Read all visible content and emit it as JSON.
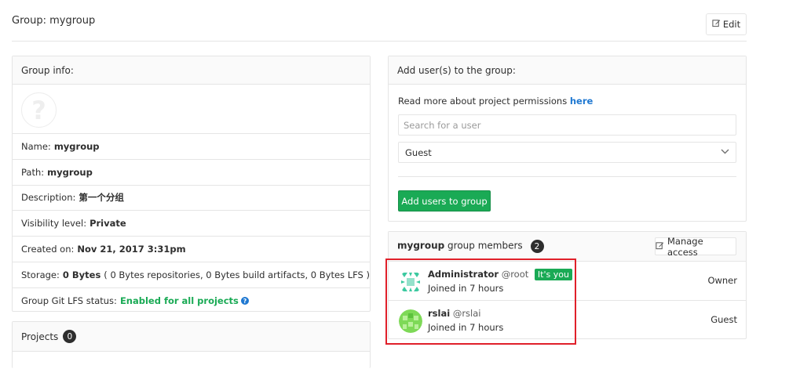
{
  "header": {
    "title": "Group: mygroup",
    "edit_label": "Edit",
    "edit_icon": "pencil-square-icon"
  },
  "group_info": {
    "heading": "Group info:",
    "avatar_icon": "question-mark-icon",
    "avatar_glyph": "?",
    "name_label": "Name:",
    "name_value": "mygroup",
    "path_label": "Path:",
    "path_value": "mygroup",
    "description_label": "Description:",
    "description_value": "第一个分组",
    "visibility_label": "Visibility level:",
    "visibility_value": "Private",
    "created_label": "Created on:",
    "created_value": "Nov 21, 2017 3:31pm",
    "storage_label": "Storage:",
    "storage_value": "0 Bytes",
    "storage_detail": "( 0 Bytes repositories, 0 Bytes build artifacts, 0 Bytes LFS )",
    "lfs_label": "Group Git LFS status:",
    "lfs_value": "Enabled for all projects",
    "lfs_help_icon": "question-circle-icon",
    "lfs_help_glyph": "?"
  },
  "projects": {
    "label": "Projects",
    "count": "0"
  },
  "add_users": {
    "heading": "Add user(s) to the group:",
    "permissions_text": "Read more about project permissions",
    "permissions_link": "here",
    "search_placeholder": "Search for a user",
    "access_level_selected": "Guest",
    "dropdown_icon": "chevron-down-icon",
    "dropdown_glyph": "⌵",
    "submit_label": "Add users to group"
  },
  "members": {
    "group_name": "mygroup",
    "title_suffix": "group members",
    "count": "2",
    "manage_label": "Manage access",
    "manage_icon": "pencil-square-icon",
    "list": [
      {
        "name": "Administrator",
        "handle": "@root",
        "badge": "It's you",
        "joined": "Joined in 7 hours",
        "role": "Owner"
      },
      {
        "name": "rslai",
        "handle": "@rslai",
        "joined": "Joined in 7 hours",
        "role": "Guest"
      }
    ]
  },
  "colors": {
    "accent_green": "#1aaa55",
    "link_blue": "#1f78d1",
    "highlight_red": "#e0202a",
    "avatar_admin": "#3cc9a0",
    "avatar_rslai": "#7ed957"
  }
}
